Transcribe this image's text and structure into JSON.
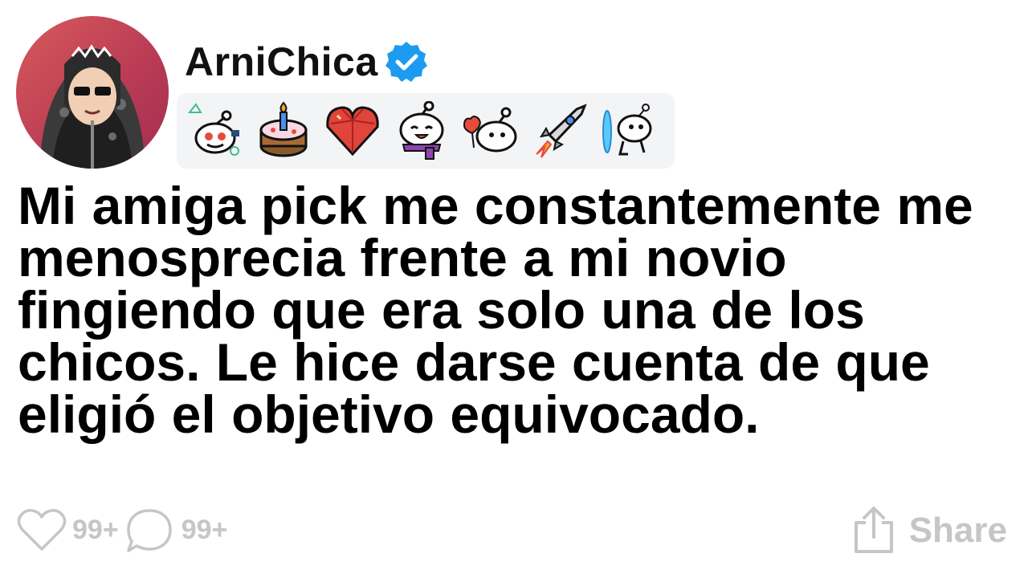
{
  "post": {
    "username": "ArniChica",
    "verified": true,
    "title": "Mi amiga pick me constantemente me menosprecia frente a mi novio fingiendo que era solo una de los chicos. Le hice darse cuenta de que eligió el objetivo equivocado."
  },
  "avatar": {
    "icon": "avatar-hooded-character",
    "background_colors": [
      "#d85a5a",
      "#a22f4f"
    ]
  },
  "awards": [
    {
      "icon": "snoo-sidetrack-icon"
    },
    {
      "icon": "birthday-cake-icon"
    },
    {
      "icon": "gem-heart-icon"
    },
    {
      "icon": "snoo-scarf-icon"
    },
    {
      "icon": "snoo-hearts-icon"
    },
    {
      "icon": "rocket-icon"
    },
    {
      "icon": "snoo-portal-icon"
    }
  ],
  "footer": {
    "likes": "99+",
    "comments": "99+",
    "share_label": "Share"
  },
  "colors": {
    "verified": "#1d9bf0",
    "muted": "#c6c6c6",
    "awards_bg": "#f3f4f6"
  }
}
